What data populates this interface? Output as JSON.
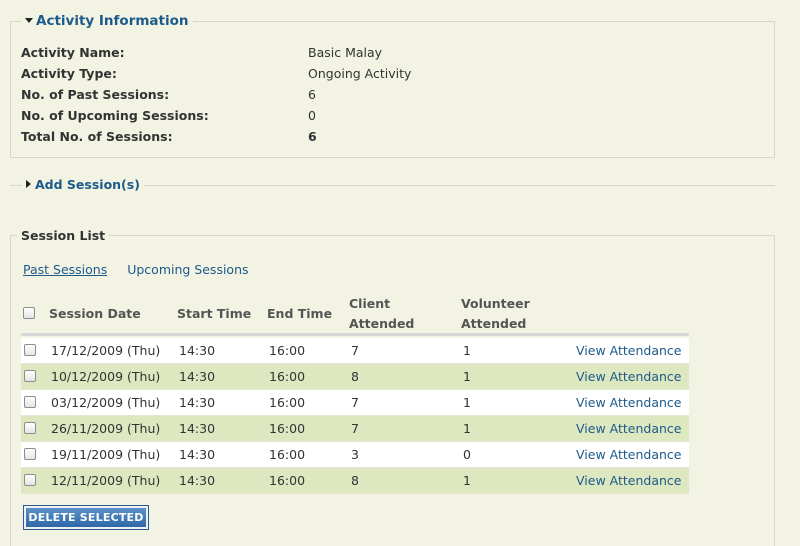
{
  "activity_info": {
    "legend": "Activity Information",
    "rows": [
      {
        "label": "Activity Name:",
        "value": "Basic Malay"
      },
      {
        "label": "Activity Type:",
        "value": "Ongoing Activity"
      },
      {
        "label": "No. of Past Sessions:",
        "value": "6"
      },
      {
        "label": "No. of Upcoming Sessions:",
        "value": "0"
      },
      {
        "label": "Total No. of Sessions:",
        "value": "6"
      }
    ]
  },
  "add_session": {
    "legend": "Add Session(s)"
  },
  "session_list": {
    "legend": "Session List",
    "tabs": [
      {
        "label": "Past Sessions",
        "active": true
      },
      {
        "label": "Upcoming Sessions",
        "active": false
      }
    ],
    "columns": {
      "session_date": "Session Date",
      "start_time": "Start Time",
      "end_time": "End Time",
      "client_attended_1": "Client",
      "client_attended_2": "Attended",
      "volunteer_attended_1": "Volunteer",
      "volunteer_attended_2": "Attended"
    },
    "rows": [
      {
        "date": "17/12/2009 (Thu)",
        "start": "14:30",
        "end": "16:00",
        "client": "7",
        "volunteer": "1",
        "action": "View Attendance"
      },
      {
        "date": "10/12/2009 (Thu)",
        "start": "14:30",
        "end": "16:00",
        "client": "8",
        "volunteer": "1",
        "action": "View Attendance"
      },
      {
        "date": "03/12/2009 (Thu)",
        "start": "14:30",
        "end": "16:00",
        "client": "7",
        "volunteer": "1",
        "action": "View Attendance"
      },
      {
        "date": "26/11/2009 (Thu)",
        "start": "14:30",
        "end": "16:00",
        "client": "7",
        "volunteer": "1",
        "action": "View Attendance"
      },
      {
        "date": "19/11/2009 (Thu)",
        "start": "14:30",
        "end": "16:00",
        "client": "3",
        "volunteer": "0",
        "action": "View Attendance"
      },
      {
        "date": "12/11/2009 (Thu)",
        "start": "14:30",
        "end": "16:00",
        "client": "8",
        "volunteer": "1",
        "action": "View Attendance"
      }
    ],
    "delete_label": "DELETE SELECTED"
  },
  "colors": {
    "background": "#f3f3e4",
    "link": "#1c5a8a",
    "row_even": "#dde7c0",
    "button": "#2e68a8"
  },
  "icons": {
    "expanded": "triangle-down-icon",
    "collapsed": "triangle-right-icon"
  }
}
